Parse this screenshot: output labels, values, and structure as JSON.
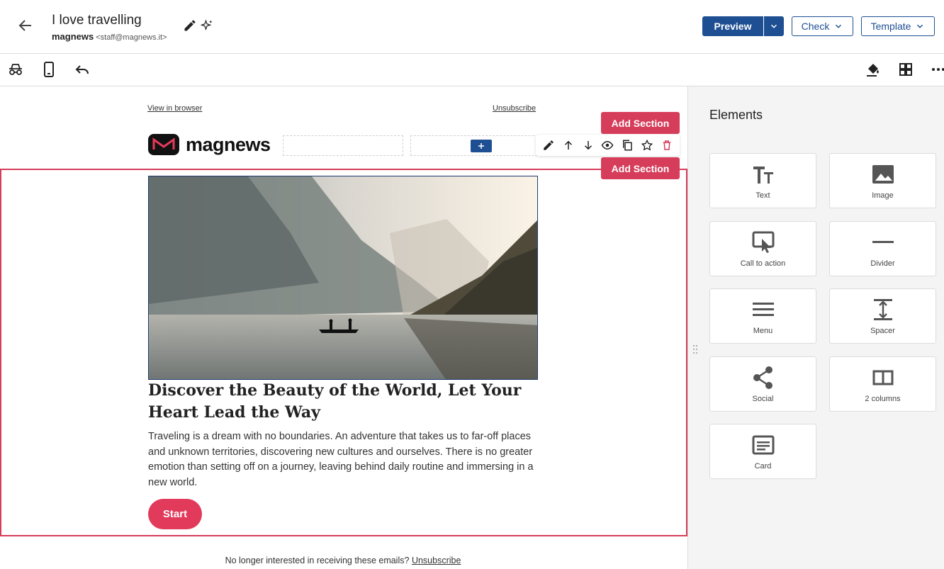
{
  "header": {
    "title": "I love travelling",
    "sender_name": "magnews",
    "sender_email": "<staff@magnews.it>",
    "preview_label": "Preview",
    "check_label": "Check",
    "template_label": "Template"
  },
  "toolbar": {
    "left_icons": [
      "incognito-icon",
      "mobile-icon",
      "undo-icon"
    ],
    "right_icons": [
      "paint-bucket-icon",
      "grid-icon",
      "more-icon"
    ]
  },
  "email": {
    "view_in_browser": "View in browser",
    "unsubscribe": "Unsubscribe",
    "add_section_label": "Add Section",
    "logo_text": "magnews",
    "headline": "Discover the Beauty of the World, Let Your Heart Lead the Way",
    "body": "Traveling is a dream with no boundaries. An adventure that takes us to far-off places and unknown territories, discovering new cultures and ourselves. There is no greater emotion than setting off on a journey, leaving behind daily routine and immersing in a new world.",
    "cta_label": "Start",
    "footer_prefix": "No longer interested in receiving these emails?",
    "footer_link": "Unsubscribe"
  },
  "panel": {
    "title": "Elements",
    "items": [
      {
        "label": "Text",
        "icon": "text-icon"
      },
      {
        "label": "Image",
        "icon": "image-icon"
      },
      {
        "label": "Call to action",
        "icon": "call-to-action-icon"
      },
      {
        "label": "Divider",
        "icon": "divider-icon"
      },
      {
        "label": "Menu",
        "icon": "menu-icon"
      },
      {
        "label": "Spacer",
        "icon": "spacer-icon"
      },
      {
        "label": "Social",
        "icon": "share-icon"
      },
      {
        "label": "2 columns",
        "icon": "two-columns-icon"
      },
      {
        "label": "Card",
        "icon": "card-icon"
      }
    ]
  },
  "colors": {
    "primary": "#1e4f92",
    "accent": "#d63d5a",
    "cta": "#e23a5a"
  }
}
